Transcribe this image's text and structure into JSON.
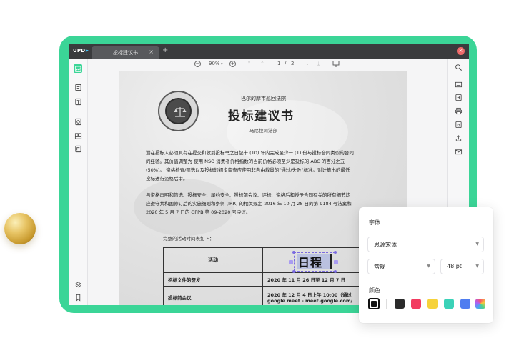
{
  "window": {
    "logo_main": "UPD",
    "logo_accent": "F",
    "tab_title": "投标建议书",
    "tab_close": "×",
    "tab_add": "+",
    "close_glyph": "×"
  },
  "toolbar": {
    "zoom_out": "−",
    "zoom_value": "90%",
    "zoom_dropdown": "▾",
    "zoom_in": "+",
    "first_page": "⤒",
    "prev_page": "⌃",
    "current_page": "1",
    "page_sep": "/",
    "total_pages": "2",
    "next_page": "⌄",
    "last_page": "⤓",
    "presentation_icon": "presentation-icon"
  },
  "document": {
    "court": "巴尔的摩市巡回法院",
    "title": "投标建议书",
    "department": "马尼拉司法部",
    "para1_lines": [
      "潜在投标人必须具有在提交和收到投标书之日起十 (10) 年内完成至少一 (1) 份与投标合同类似的合同",
      "的经验。其价值调整为 使用 NSO 消费者价格指数的当前价格必须至少是投标的 ABC 的百分之五十",
      "(50%)。 资格检查/筛选以及投标的初步审查应使用非自由裁量的\"通过/失败\"标准。对计算出的最低",
      "投标进行资格后审。"
    ],
    "para2_lines": [
      "与资格声明和筛选、投标安全、履约安全、投标前会议、评标、资格后和授予合同有关的所有细节均",
      "应遵守共和国修订后的实施细则和条例 (IRR) 的相关规定 2016 年 10 月 28 日的第 9184 号法案和",
      "2020 年 5 月 7 日的 GPPB 第 09-2020 号决议。"
    ],
    "schedule_label": "完整的活动时间表如下：",
    "table": {
      "header_activity": "活动",
      "header_schedule": "日程",
      "rows": [
        {
          "activity": "招标文件的签发",
          "date": "2020 年 11 月 26 日至 12 月 7 日"
        },
        {
          "activity": "投标前会议",
          "date_line1": "2020 年 12 月 4 日上午 10:00（通过",
          "date_line2": "google meet - meet.google.com/"
        }
      ]
    }
  },
  "font_panel": {
    "font_label": "字体",
    "font_family": "思源宋体",
    "font_style": "常规",
    "font_size": "48 pt",
    "color_label": "颜色",
    "swatches": [
      "#111111",
      "#2b2b2b",
      "#f23b60",
      "#f6d23a",
      "#3bd2b8",
      "#4f7df0",
      "rainbow"
    ]
  },
  "left_icons": [
    "thumbnail-icon",
    "comment-icon",
    "edit-icon",
    "stamp-icon",
    "organize-icon",
    "crop-icon",
    "layers-icon",
    "bookmark-icon"
  ],
  "right_icons": [
    "search-icon",
    "ocr-icon",
    "convert-icon",
    "print-icon",
    "protect-icon",
    "share-icon",
    "email-icon"
  ]
}
